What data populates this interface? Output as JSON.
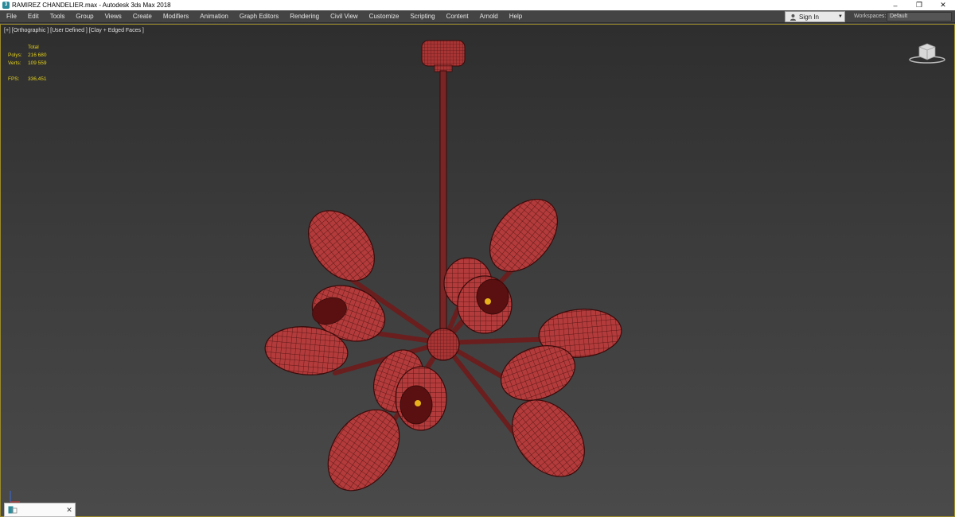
{
  "window": {
    "title": "RAMIREZ CHANDELIER.max - Autodesk 3ds Max 2018",
    "app_icon": "3ds-max-icon",
    "controls": {
      "minimize": "–",
      "restore": "❐",
      "close": "✕"
    }
  },
  "menubar": {
    "items": [
      "File",
      "Edit",
      "Tools",
      "Group",
      "Views",
      "Create",
      "Modifiers",
      "Animation",
      "Graph Editors",
      "Rendering",
      "Civil View",
      "Customize",
      "Scripting",
      "Content",
      "Arnold",
      "Help"
    ],
    "sign_in": "Sign In",
    "workspaces_label": "Workspaces:",
    "workspace_value": "Default"
  },
  "viewport": {
    "label": "[+] [Orthographic ] [User Defined ] [Clay + Edged Faces ]",
    "stats": {
      "header": "Total",
      "polys_label": "Polys:",
      "polys_value": "216 680",
      "verts_label": "Verts:",
      "verts_value": "109 559",
      "fps_label": "FPS:",
      "fps_value": "336,451"
    },
    "viewcube_icon": "viewcube-icon",
    "model": "chandelier-model",
    "colors": {
      "mesh_fill": "#b23a3a",
      "mesh_wire": "#4a0f0f",
      "bulb": "#e8b21a",
      "stats_text": "#e5d21a"
    }
  },
  "mini_panel": {
    "close": "✕"
  }
}
